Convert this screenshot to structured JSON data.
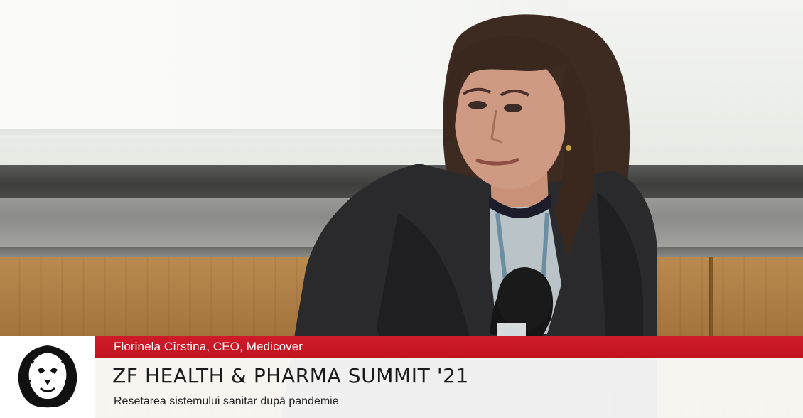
{
  "video": {
    "scene_description_icon": "speaker-at-podium-video-frame"
  },
  "lower_third": {
    "logo_icon": "lion-head-logo-icon",
    "speaker_line": "Florinela Cîrstina, CEO, Medicover",
    "event_title": "ZF HEALTH & PHARMA SUMMIT '21",
    "session_title": "Resetarea sistemului sanitar după pandemie"
  },
  "colors": {
    "accent_red": "#c8102e",
    "title_bar": "#ffffff",
    "text_dark": "#1b1b1b"
  }
}
